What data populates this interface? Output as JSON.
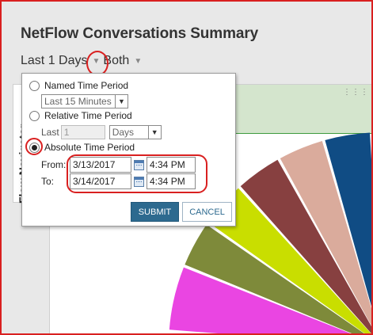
{
  "page": {
    "title": "NetFlow Conversations Summary",
    "time_selector": "Last 1 Days",
    "direction_selector": "Both"
  },
  "side_widget": {
    "title_fragment": "Flow Navigator"
  },
  "popup": {
    "named_label": "Named Time Period",
    "named_value": "Last 15 Minutes",
    "relative_label": "Relative Time Period",
    "relative_prefix": "Last",
    "relative_count": "1",
    "relative_unit": "Days",
    "absolute_label": "Absolute Time Period",
    "absolute_selected": true,
    "from_label": "From:",
    "from_date": "3/13/2017",
    "from_time": "4:34 PM",
    "to_label": "To:",
    "to_date": "3/14/2017",
    "to_time": "4:34 PM",
    "submit_label": "SUBMIT",
    "cancel_label": "CANCEL"
  },
  "widget": {
    "menu_icon": "drag-handle-icon"
  },
  "pie_colors": [
    "#ea45e2",
    "#7e8a3a",
    "#c9de00",
    "#874040",
    "#daab9c",
    "#104c84"
  ],
  "icons": {
    "calendar": "calendar-icon",
    "dropdown": "chevron-down-icon"
  }
}
